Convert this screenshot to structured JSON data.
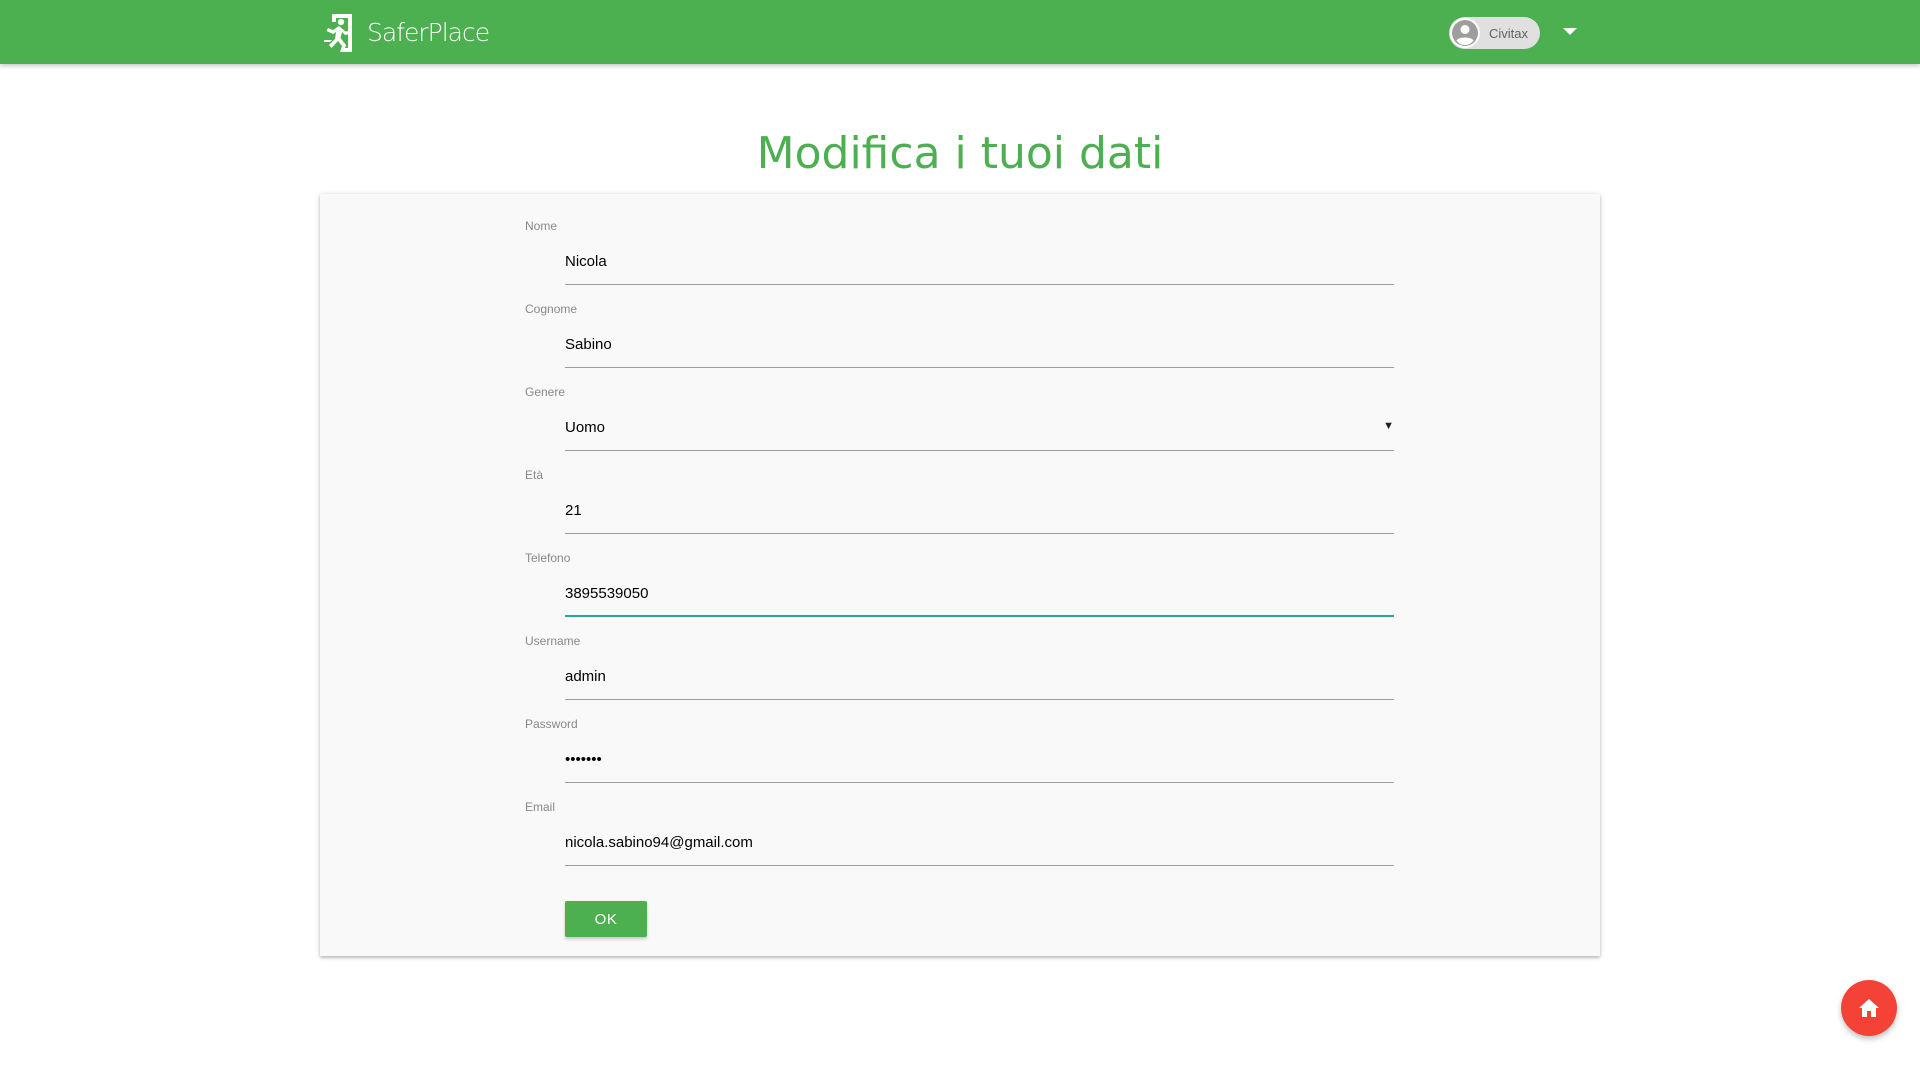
{
  "header": {
    "brand": "SaferPlace",
    "user_name": "Civitax",
    "icons": {
      "logo": "emergency-exit-icon",
      "avatar": "account-circle-icon",
      "menu": "caret-down-icon"
    }
  },
  "page": {
    "title": "Modifica i tuoi dati"
  },
  "form": {
    "fields": [
      {
        "label": "Nome",
        "value": "Nicola",
        "type": "text"
      },
      {
        "label": "Cognome",
        "value": "Sabino",
        "type": "text"
      },
      {
        "label": "Genere",
        "value": "Uomo",
        "type": "select"
      },
      {
        "label": "Età",
        "value": "21",
        "type": "text"
      },
      {
        "label": "Telefono",
        "value": "3895539050",
        "type": "text",
        "focused": true
      },
      {
        "label": "Username",
        "value": "admin",
        "type": "text"
      },
      {
        "label": "Password",
        "value": "•••••••",
        "type": "password"
      },
      {
        "label": "Email",
        "value": "nicola.sabino94@gmail.com",
        "type": "text"
      }
    ],
    "submit_label": "OK"
  },
  "fab": {
    "icon": "home-icon"
  },
  "colors": {
    "primary": "#4caf50",
    "focus_underline": "#26a69a",
    "fab": "#f44336",
    "card_background": "#f9f9f9"
  }
}
